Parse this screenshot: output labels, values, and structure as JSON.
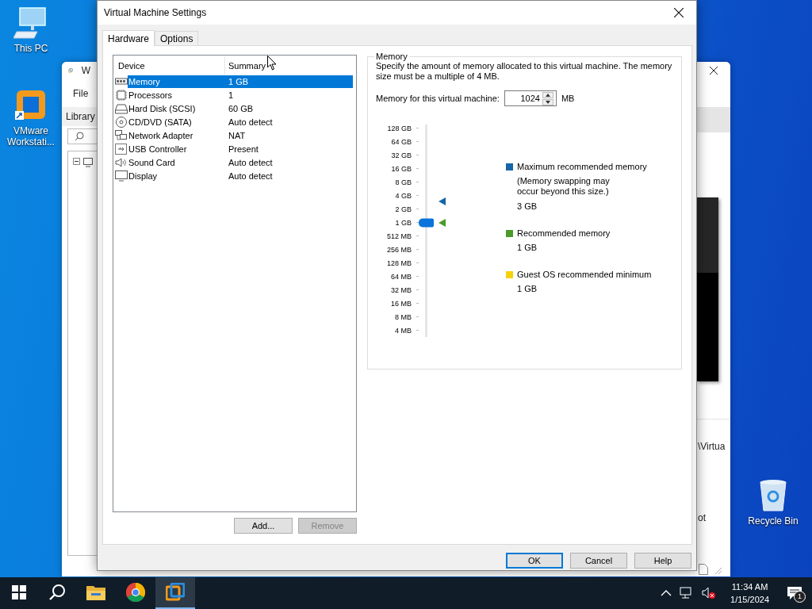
{
  "desktop": {
    "left_icons": [
      {
        "kind": "computer",
        "label": "This PC"
      },
      {
        "kind": "vmware",
        "label": "VMware Workstati..."
      }
    ],
    "right_icons": [
      {
        "kind": "recycle-bin",
        "label": "Recycle Bin"
      }
    ]
  },
  "background_window": {
    "title": "W",
    "menu": [
      "File"
    ],
    "library_label": "Library",
    "path_text": "\\Virtua",
    "text_fragment": "ot"
  },
  "dialog": {
    "title": "Virtual Machine Settings",
    "tabs": [
      {
        "label": "Hardware",
        "selected": true
      },
      {
        "label": "Options",
        "selected": false
      }
    ],
    "device_table": {
      "columns": [
        "Device",
        "Summary"
      ],
      "rows": [
        {
          "kind": "memory",
          "device": "Memory",
          "summary": "1 GB",
          "selected": true
        },
        {
          "kind": "processor",
          "device": "Processors",
          "summary": "1",
          "selected": false
        },
        {
          "kind": "disk",
          "device": "Hard Disk (SCSI)",
          "summary": "60 GB",
          "selected": false
        },
        {
          "kind": "cd",
          "device": "CD/DVD (SATA)",
          "summary": "Auto detect",
          "selected": false
        },
        {
          "kind": "network",
          "device": "Network Adapter",
          "summary": "NAT",
          "selected": false
        },
        {
          "kind": "usb",
          "device": "USB Controller",
          "summary": "Present",
          "selected": false
        },
        {
          "kind": "sound",
          "device": "Sound Card",
          "summary": "Auto detect",
          "selected": false
        },
        {
          "kind": "display",
          "device": "Display",
          "summary": "Auto detect",
          "selected": false
        }
      ]
    },
    "device_buttons": [
      {
        "label": "Add...",
        "disabled": false
      },
      {
        "label": "Remove",
        "disabled": true
      }
    ],
    "memory": {
      "title": "Memory",
      "description": "Specify the amount of memory allocated to this virtual machine. The memory size must be a multiple of 4 MB.",
      "field_label": "Memory for this virtual machine:",
      "value": "1024",
      "unit": "MB",
      "scale": [
        "128 GB",
        "64 GB",
        "32 GB",
        "16 GB",
        "8 GB",
        "4 GB",
        "2 GB",
        "1 GB",
        "512 MB",
        "256 MB",
        "128 MB",
        "64 MB",
        "32 MB",
        "16 MB",
        "8 MB",
        "4 MB"
      ],
      "slider": {
        "level": 0.533
      },
      "legend": [
        {
          "label": "Maximum recommended memory",
          "note": "(Memory swapping may occur beyond this size.)",
          "value": "3 GB",
          "color": "#1565a8",
          "level": 0.639
        },
        {
          "label": "Recommended memory",
          "value": "1 GB",
          "color": "#4a9a2a",
          "level": 0.533
        },
        {
          "label": "Guest OS recommended minimum",
          "value": "1 GB",
          "color": "#f7d20a"
        }
      ]
    },
    "buttons": [
      {
        "label": "OK",
        "default": true
      },
      {
        "label": "Cancel",
        "default": false
      },
      {
        "label": "Help",
        "default": false
      }
    ]
  },
  "taskbar": {
    "apps": [
      {
        "kind": "start",
        "active": false
      },
      {
        "kind": "search",
        "active": false
      },
      {
        "kind": "folder",
        "active": false
      },
      {
        "kind": "browser",
        "active": false
      },
      {
        "kind": "vmware",
        "active": true
      }
    ],
    "time": "11:34 AM",
    "date": "1/15/2024",
    "notification_count": "1"
  }
}
